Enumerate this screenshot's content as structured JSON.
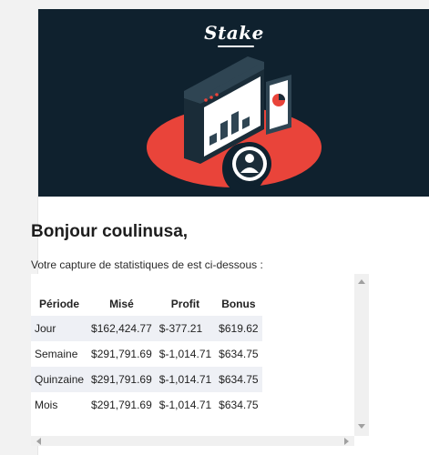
{
  "banner": {
    "logo_text": "Stake"
  },
  "greeting": "Bonjour coulinusa,",
  "intro": "Votre capture de statistiques de est ci-dessous :",
  "table": {
    "headers": [
      "Période",
      "Misé",
      "Profit",
      "Bonus"
    ],
    "rows": [
      [
        "Jour",
        "$162,424.77",
        "$-377.21",
        "$619.62"
      ],
      [
        "Semaine",
        "$291,791.69",
        "$-1,014.71",
        "$634.75"
      ],
      [
        "Quinzaine",
        "$291,791.69",
        "$-1,014.71",
        "$634.75"
      ],
      [
        "Mois",
        "$291,791.69",
        "$-1,014.71",
        "$634.75"
      ]
    ]
  },
  "icons": [
    "stake-logo",
    "dashboard-illustration",
    "user-avatar-icon",
    "scroll-up-icon",
    "scroll-down-icon",
    "scroll-left-icon",
    "scroll-right-icon"
  ],
  "colors": {
    "banner_bg": "#0f212e",
    "accent_red": "#e9443a",
    "row_shade": "#eef0f5"
  }
}
